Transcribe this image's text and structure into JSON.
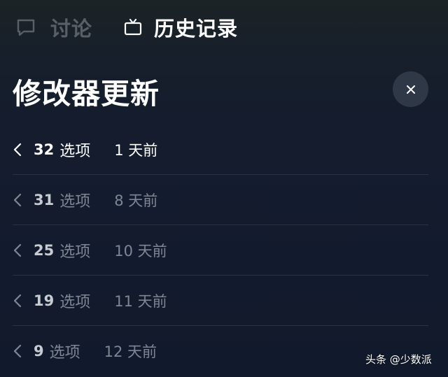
{
  "tabs": [
    {
      "label": "讨论",
      "icon": "chat-bubble-icon",
      "state": "inactive"
    },
    {
      "label": "历史记录",
      "icon": "tv-history-icon",
      "state": "active"
    }
  ],
  "panel": {
    "title": "修改器更新",
    "close_icon": "close-icon"
  },
  "updates": [
    {
      "count": "32",
      "unit": "选项",
      "ago": "1 天前",
      "active": true
    },
    {
      "count": "31",
      "unit": "选项",
      "ago": "8 天前",
      "active": false
    },
    {
      "count": "25",
      "unit": "选项",
      "ago": "10 天前",
      "active": false
    },
    {
      "count": "19",
      "unit": "选项",
      "ago": "11 天前",
      "active": false
    },
    {
      "count": "9",
      "unit": "选项",
      "ago": "12 天前",
      "active": false
    }
  ],
  "watermark": "头条 @少数派",
  "colors": {
    "background": "#111a2c",
    "close_button_bg": "#2f3847",
    "divider": "#2b3342",
    "dim_text": "#7f8693"
  }
}
